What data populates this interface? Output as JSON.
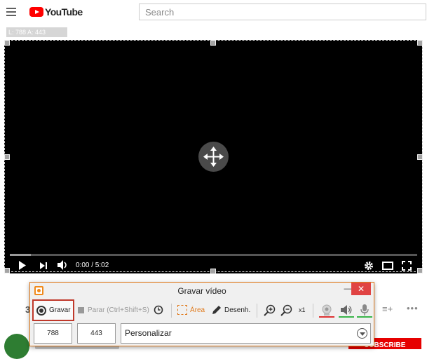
{
  "youtube": {
    "logo_text": "YouTube",
    "search_placeholder": "Search"
  },
  "selection": {
    "dimension_label": "L: 788 A: 443"
  },
  "player": {
    "time": "0:00 / 5:02"
  },
  "page": {
    "subscribe_label": "SUBSCRIBE"
  },
  "recorder": {
    "title": "Gravar vídeo",
    "record_label": "Gravar",
    "stop_label": "Parar (Ctrl+Shift+S)",
    "area_label": "Área",
    "draw_label": "Desenh.",
    "zoom_level": "x1",
    "width_value": "788",
    "height_value": "443",
    "preset_value": "Personalizar",
    "accent_color": "#f08a1c"
  }
}
